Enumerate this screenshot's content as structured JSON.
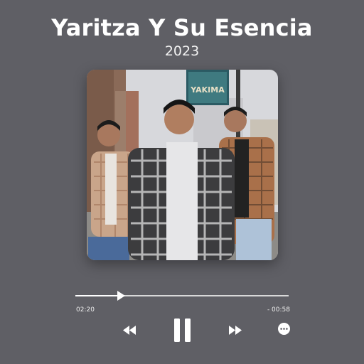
{
  "track": {
    "title": "Yaritza Y Su Esencia",
    "year": "2023"
  },
  "player": {
    "elapsed": "02:20",
    "remaining": "- 00:58",
    "progress_fraction": 0.205
  },
  "album_art": {
    "sign_text": "YAKIMA"
  },
  "icons": {
    "rewind": "rewind-icon",
    "pause": "pause-icon",
    "fast_forward": "fast-forward-icon",
    "more": "more-options-icon"
  },
  "colors": {
    "background": "#5f5f65",
    "text": "#ffffff"
  }
}
